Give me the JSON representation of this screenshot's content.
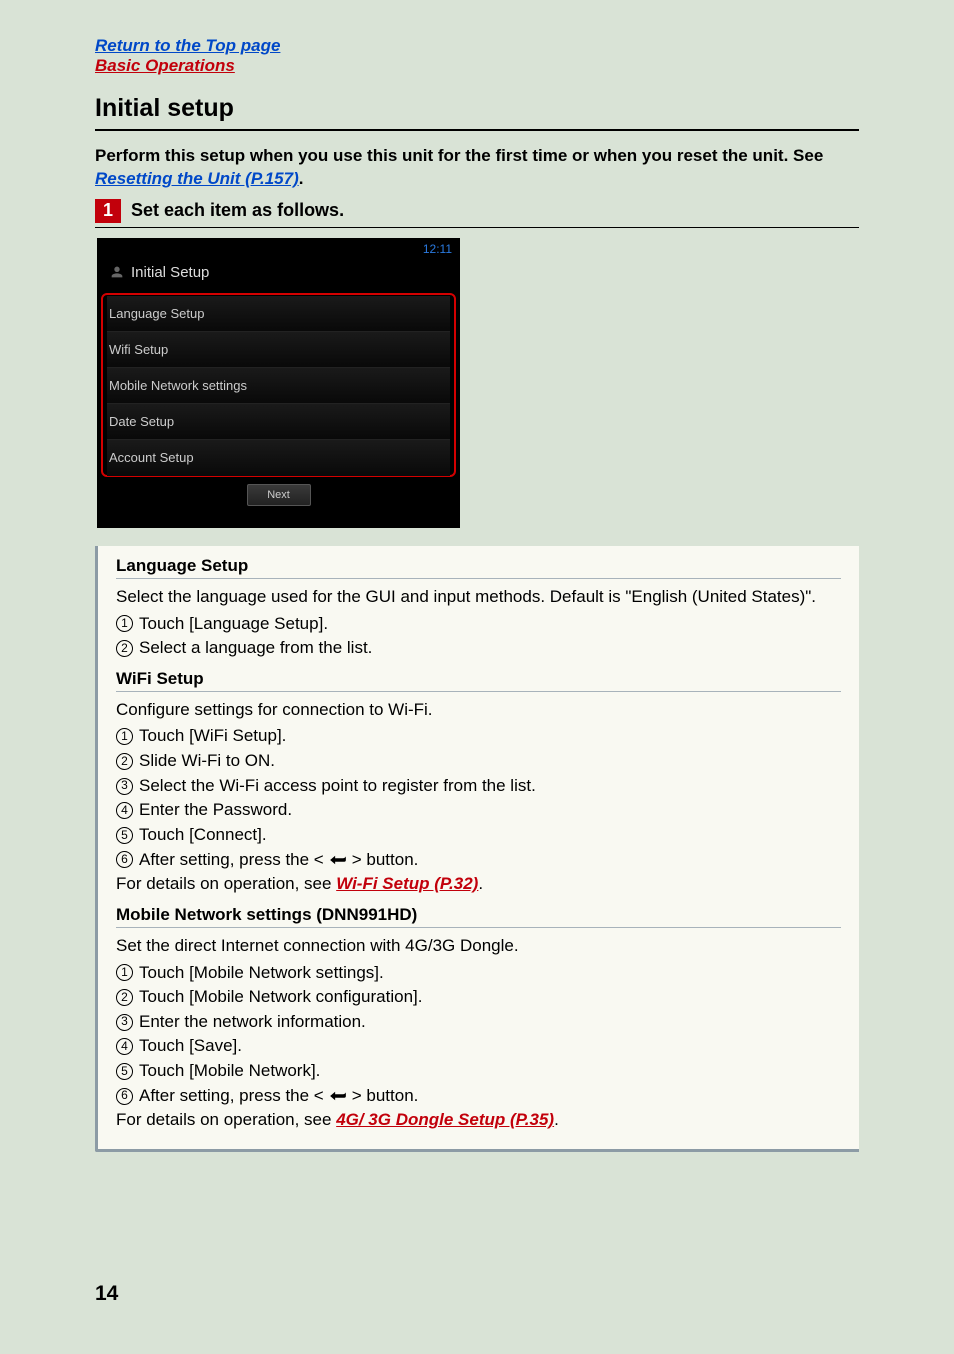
{
  "topLinks": {
    "returnTop": "Return to the Top page",
    "basicOps": "Basic Operations"
  },
  "title": "Initial setup",
  "intro": {
    "part1": "Perform this setup when you use this unit for the first time or when you reset the unit. See ",
    "linkText": "Resetting the Unit (P.157)",
    "part2": "."
  },
  "step1": {
    "num": "1",
    "text": "Set each item as follows."
  },
  "screenshot": {
    "clock": "12:11",
    "header": "Initial Setup",
    "items": [
      "Language Setup",
      "Wifi Setup",
      "Mobile Network settings",
      "Date Setup",
      "Account Setup"
    ],
    "nextBtn": "Next"
  },
  "sections": [
    {
      "title": "Language Setup",
      "desc": "Select the language used for the GUI and input methods. Default is \"English (United States)\".",
      "steps": [
        {
          "n": "1",
          "text": "Touch [Language Setup]."
        },
        {
          "n": "2",
          "text": "Select a language from the list."
        }
      ]
    },
    {
      "title": "WiFi Setup",
      "desc": "Configure settings for connection to Wi-Fi.",
      "steps": [
        {
          "n": "1",
          "text": "Touch [WiFi Setup]."
        },
        {
          "n": "2",
          "text": "Slide Wi-Fi to ON."
        },
        {
          "n": "3",
          "text": "Select the Wi-Fi access point to register from the list."
        },
        {
          "n": "4",
          "text": "Enter the Password."
        },
        {
          "n": "5",
          "text": "Touch [Connect]."
        },
        {
          "n": "6",
          "text": "After setting, press the < ",
          "hasBackIcon": true,
          "textAfter": " > button."
        }
      ],
      "footer": {
        "pre": "For details on operation, see ",
        "link": "Wi-Fi Setup (P.32)",
        "post": "."
      }
    },
    {
      "title": "Mobile Network settings (DNN991HD)",
      "desc": "Set the direct Internet connection with 4G/3G Dongle.",
      "steps": [
        {
          "n": "1",
          "text": "Touch [Mobile Network settings]."
        },
        {
          "n": "2",
          "text": "Touch [Mobile Network configuration]."
        },
        {
          "n": "3",
          "text": "Enter the network information."
        },
        {
          "n": "4",
          "text": "Touch [Save]."
        },
        {
          "n": "5",
          "text": "Touch [Mobile Network]."
        },
        {
          "n": "6",
          "text": "After setting, press the < ",
          "hasBackIcon": true,
          "textAfter": " > button."
        }
      ],
      "footer": {
        "pre": "For details on operation, see ",
        "link": "4G/ 3G Dongle Setup (P.35)",
        "post": "."
      }
    }
  ],
  "pageNumber": "14"
}
